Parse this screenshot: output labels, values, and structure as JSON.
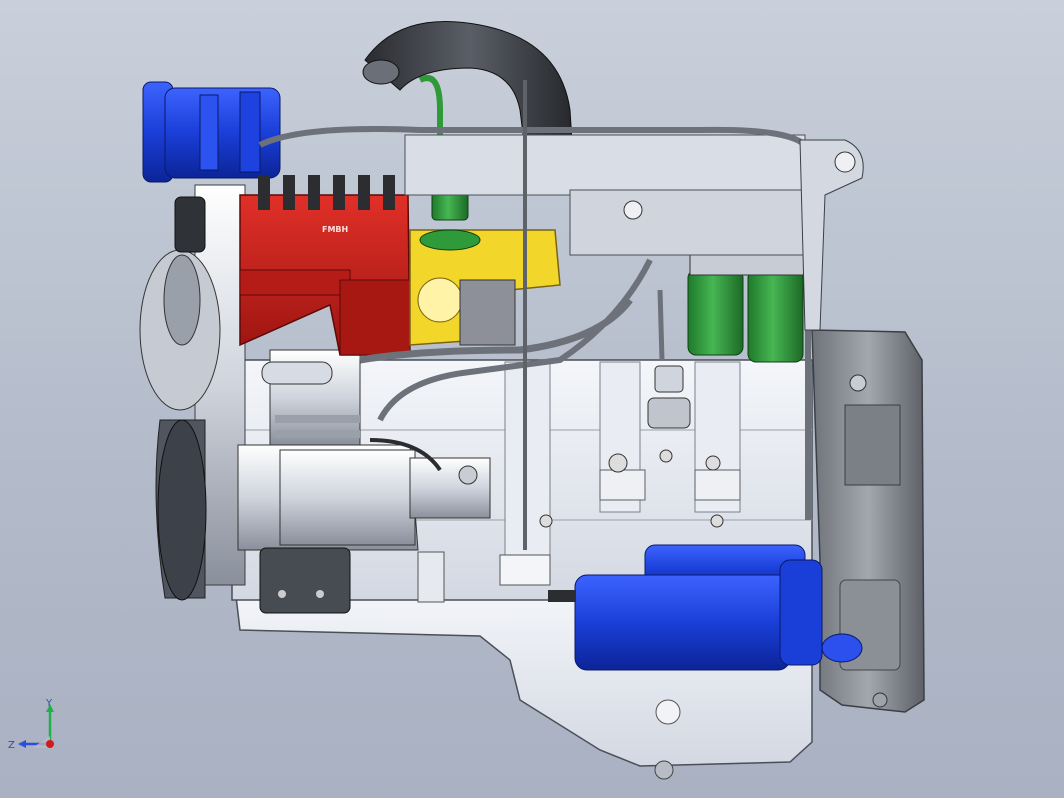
{
  "window": {
    "title": ""
  },
  "model": {
    "subject": "diesel-engine-assembly",
    "view": "side",
    "fuel_pump_label": "FMBH"
  },
  "triad": {
    "x_label": "",
    "y_label": "Y",
    "z_label": "Z"
  },
  "colors": {
    "background_top": "#c9d0db",
    "background_bottom": "#a9b1c2",
    "engine_block": "#e8ebf1",
    "fuel_pump": "#c0201b",
    "governor_bracket": "#f2d62a",
    "compressor_and_starter": "#1b3fd6",
    "filters": "#2f9a3a",
    "flywheel_housing": "#8c8f96",
    "turbo_hose": "#3a3d42"
  }
}
